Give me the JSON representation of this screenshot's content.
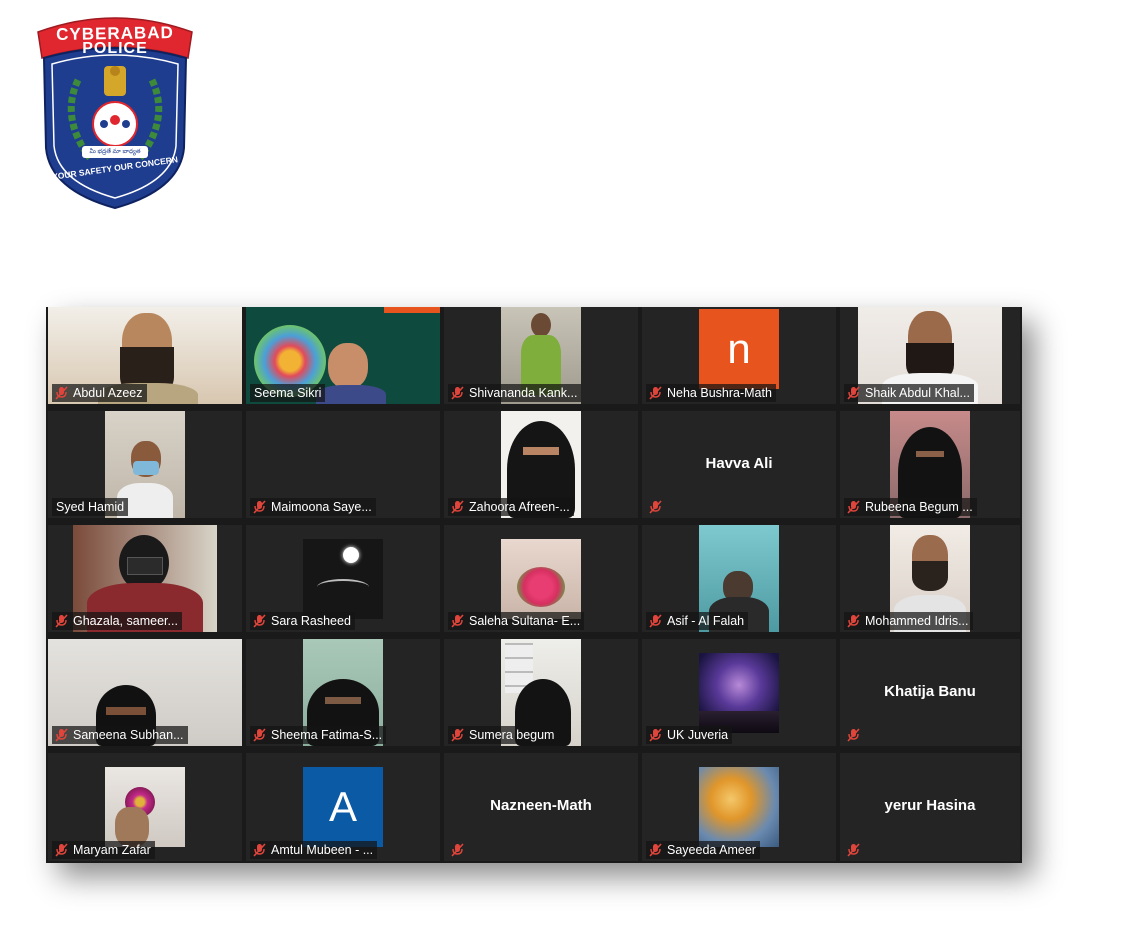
{
  "logo": {
    "top_text": "CYBERABAD",
    "sub_text": "POLICE",
    "motto": "YOUR SAFETY  OUR CONCERN",
    "ribbon_text": "మీ భద్రతే మా బాధ్యత",
    "colors": {
      "red": "#e0262e",
      "navy": "#1f3d8f",
      "wreath": "#3d8b3a",
      "gold": "#d4a62a"
    }
  },
  "participants": [
    {
      "name": "Abdul Azeez",
      "muted": true,
      "video": true,
      "active": false
    },
    {
      "name": "Seema Sikri",
      "muted": false,
      "video": true,
      "active": true
    },
    {
      "name": "Shivananda Kank...",
      "muted": true,
      "video": true,
      "active": false
    },
    {
      "name": "Neha Bushra-Math",
      "muted": true,
      "video": false,
      "avatar_letter": "n",
      "avatar_color": "#e8541e"
    },
    {
      "name": "Shaik Abdul Khal...",
      "muted": true,
      "video": true
    },
    {
      "name": "Syed Hamid",
      "muted": false,
      "video": true
    },
    {
      "name": "Maimoona Saye...",
      "muted": true,
      "video": false
    },
    {
      "name": "Zahoora Afreen-...",
      "muted": true,
      "video": true
    },
    {
      "name": "Havva Ali",
      "muted": true,
      "video": false
    },
    {
      "name": "Rubeena Begum ...",
      "muted": true,
      "video": true
    },
    {
      "name": "Ghazala, sameer...",
      "muted": true,
      "video": true
    },
    {
      "name": "Sara Rasheed",
      "muted": true,
      "video": true
    },
    {
      "name": "Saleha Sultana- E...",
      "muted": true,
      "video": true
    },
    {
      "name": "Asif - Al Falah",
      "muted": true,
      "video": true
    },
    {
      "name": "Mohammed Idris...",
      "muted": true,
      "video": true
    },
    {
      "name": "Sameena Subhan...",
      "muted": true,
      "video": true
    },
    {
      "name": "Sheema Fatima-S...",
      "muted": true,
      "video": true
    },
    {
      "name": "Sumera begum",
      "muted": true,
      "video": true
    },
    {
      "name": "UK Juveria",
      "muted": true,
      "video": true
    },
    {
      "name": "Khatija Banu",
      "muted": true,
      "video": false
    },
    {
      "name": "Maryam Zafar",
      "muted": true,
      "video": true
    },
    {
      "name": "Amtul Mubeen - ...",
      "muted": true,
      "video": false,
      "avatar_letter": "A",
      "avatar_color": "#0b5aa6"
    },
    {
      "name": "Nazneen-Math",
      "muted": true,
      "video": false
    },
    {
      "name": "Sayeeda Ameer",
      "muted": true,
      "video": true
    },
    {
      "name": "yerur Hasina",
      "muted": true,
      "video": false
    }
  ]
}
